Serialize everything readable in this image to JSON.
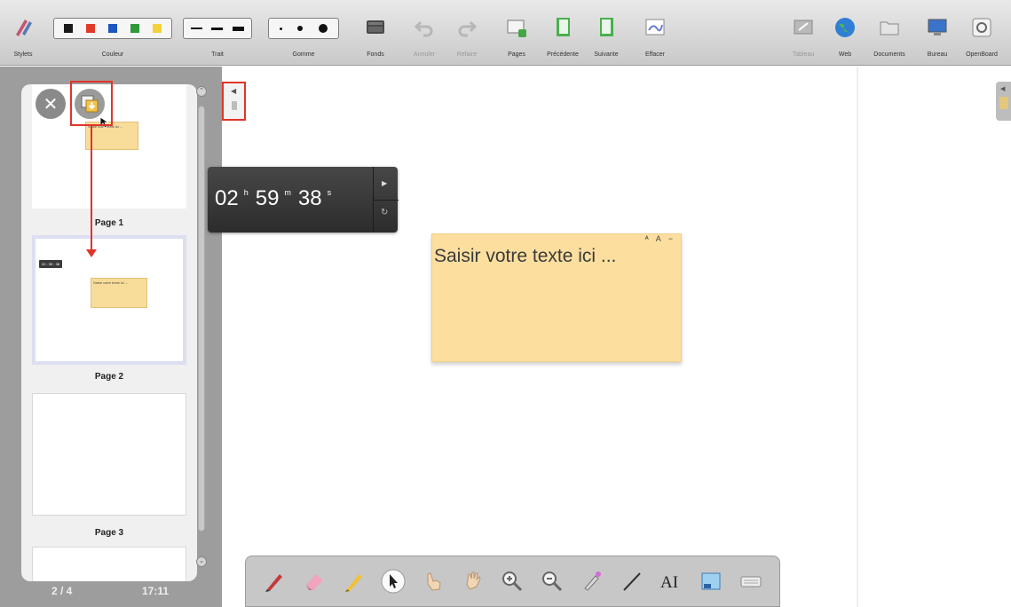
{
  "toolbar": {
    "groups": [
      {
        "label": "Stylets"
      },
      {
        "label": "Couleur"
      },
      {
        "label": "Trait"
      },
      {
        "label": "Gomme"
      },
      {
        "label": "Fonds"
      },
      {
        "label": "Annuler"
      },
      {
        "label": "Refaire"
      },
      {
        "label": "Pages"
      },
      {
        "label": "Précédente"
      },
      {
        "label": "Suivante"
      },
      {
        "label": "Effacer"
      },
      {
        "label": "Tableau"
      },
      {
        "label": "Web"
      },
      {
        "label": "Documents"
      },
      {
        "label": "Bureau"
      },
      {
        "label": "OpenBoard"
      }
    ],
    "colors": [
      "#1a1a1a",
      "#e03a2a",
      "#1d56c2",
      "#2e9a3a",
      "#f4d23a"
    ]
  },
  "pages_panel": {
    "thumbnails": [
      {
        "label": "Page 1",
        "note_text": "Saisir votre texte ici ..."
      },
      {
        "label": "Page 2",
        "timer_text": "02 : 59 : 38",
        "note_text": "Saisir votre texte ici ..."
      },
      {
        "label": "Page 3"
      }
    ],
    "page_indicator": "2 / 4",
    "clock": "17:11"
  },
  "board": {
    "timer": {
      "hours": "02",
      "hours_unit": "h",
      "minutes": "59",
      "minutes_unit": "m",
      "seconds": "38",
      "seconds_unit": "s"
    },
    "note": {
      "text": "Saisir votre texte ici ...",
      "controls": "ᴬ A −"
    }
  },
  "palette": {
    "tools": [
      {
        "name": "pen"
      },
      {
        "name": "eraser"
      },
      {
        "name": "marker"
      },
      {
        "name": "selector"
      },
      {
        "name": "interact"
      },
      {
        "name": "hand"
      },
      {
        "name": "zoom-in"
      },
      {
        "name": "zoom-out"
      },
      {
        "name": "laser-pointer"
      },
      {
        "name": "line"
      },
      {
        "name": "text"
      },
      {
        "name": "capture"
      },
      {
        "name": "virtual-keyboard"
      }
    ]
  },
  "theme": {
    "accent_red": "#e0342b",
    "note_yellow": "#fcdf9f",
    "timer_bg": "#3a3a3a"
  }
}
